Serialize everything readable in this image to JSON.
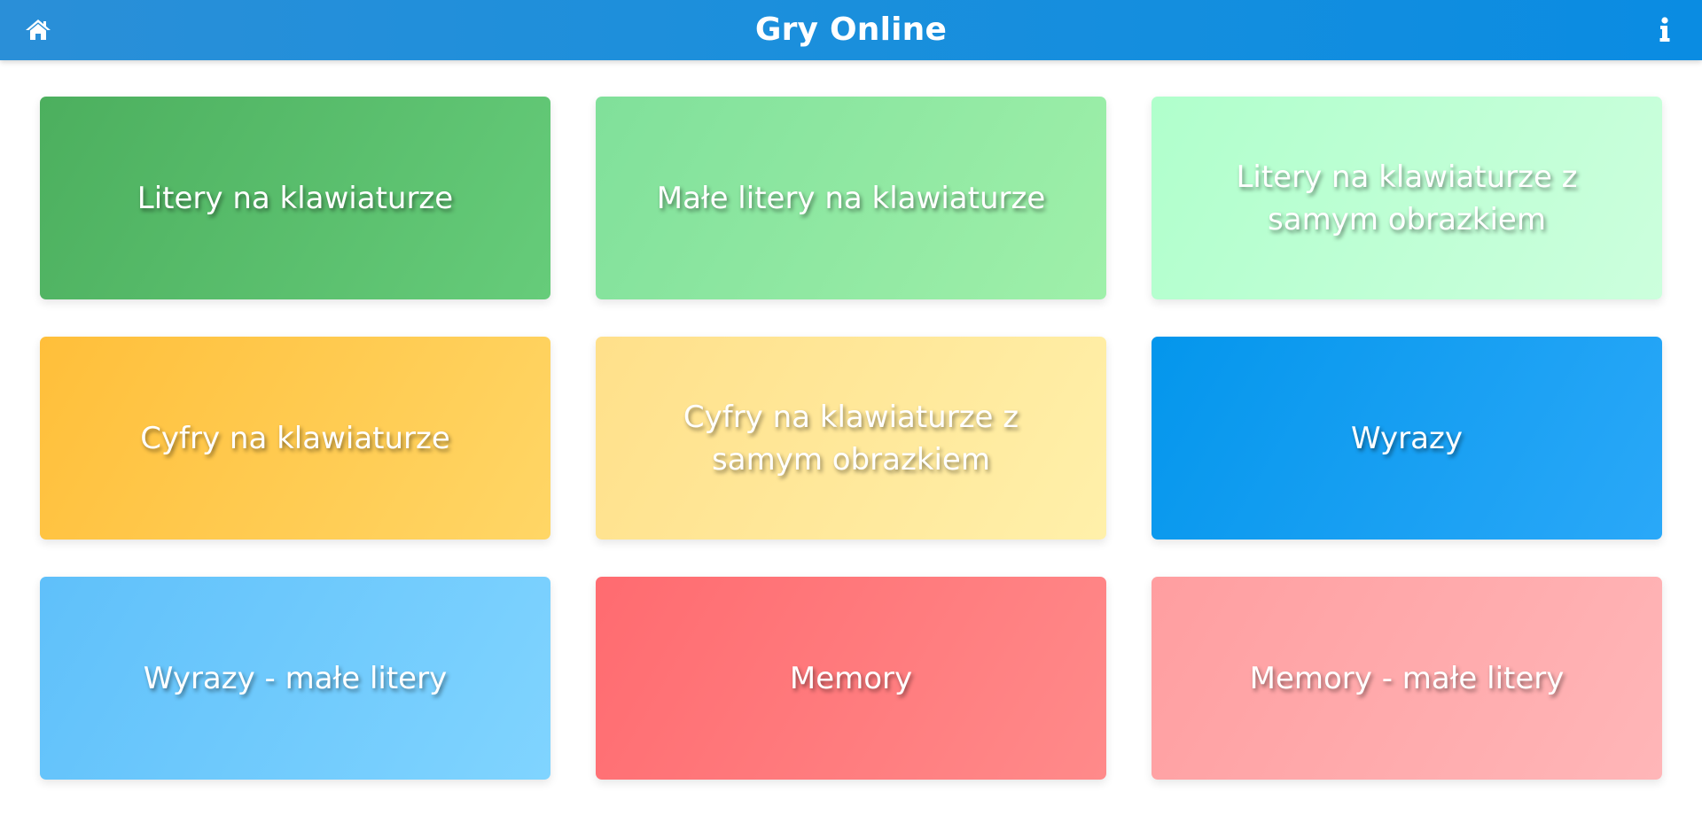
{
  "header": {
    "title": "Gry Online",
    "home_icon": "home-icon",
    "info_icon": "info-icon"
  },
  "tiles": [
    {
      "label": "Litery na klawiaturze",
      "color_from": "#4caf5e",
      "color_to": "#66cc7a"
    },
    {
      "label": "Małe litery na klawiaturze",
      "color_from": "#80e09a",
      "color_to": "#9ff0aa"
    },
    {
      "label": "Litery na klawiaturze z samym obrazkiem",
      "color_from": "#b0ffcc",
      "color_to": "#ccffdd"
    },
    {
      "label": "Cyfry na klawiaturze",
      "color_from": "#ffbf3a",
      "color_to": "#ffd666"
    },
    {
      "label": "Cyfry na klawiaturze z samym obrazkiem",
      "color_from": "#ffe08a",
      "color_to": "#fff0aa"
    },
    {
      "label": "Wyrazy",
      "color_from": "#0496ec",
      "color_to": "#2aa8f8"
    },
    {
      "label": "Wyrazy - małe litery",
      "color_from": "#5fc0fa",
      "color_to": "#80d4ff"
    },
    {
      "label": "Memory",
      "color_from": "#ff6b70",
      "color_to": "#ff8a8a"
    },
    {
      "label": "Memory - małe litery",
      "color_from": "#ff9ea0",
      "color_to": "#ffb6b8"
    }
  ]
}
